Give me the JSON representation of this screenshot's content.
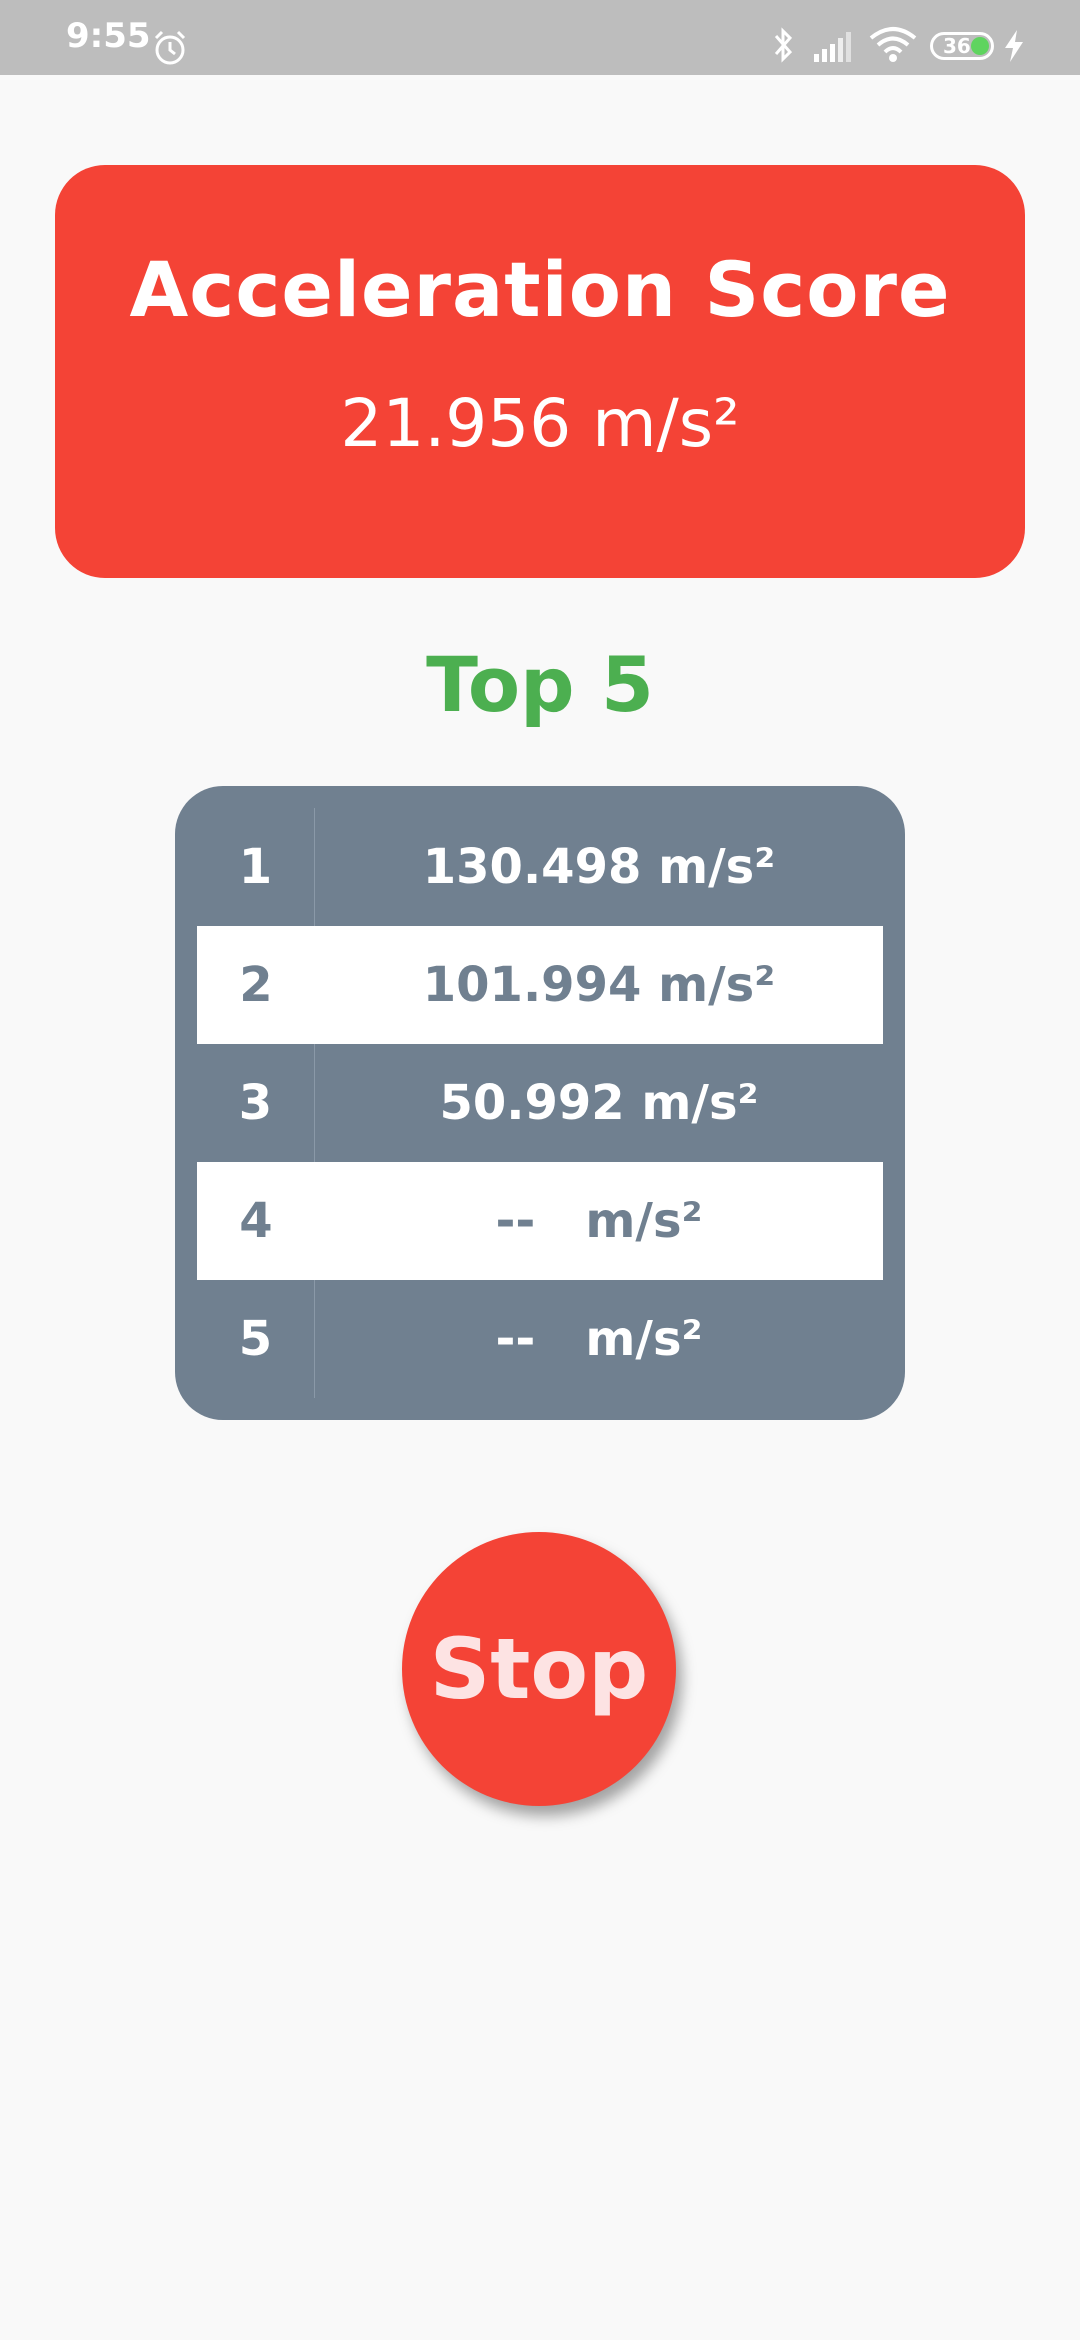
{
  "status_bar": {
    "time": "9:55",
    "battery_level": "36",
    "icons": [
      "alarm-icon",
      "bluetooth-icon",
      "signal-icon",
      "wifi-icon",
      "battery-icon",
      "charging-bolt-icon"
    ]
  },
  "score_card": {
    "title": "Acceleration Score",
    "value": "21.956 m/s²",
    "color": "#f44336"
  },
  "top5": {
    "title": "Top 5",
    "color": "#4caf50",
    "rows": [
      {
        "rank": "1",
        "value": "130.498 m/s²"
      },
      {
        "rank": "2",
        "value": "101.994 m/s²"
      },
      {
        "rank": "3",
        "value": "50.992 m/s²"
      },
      {
        "rank": "4",
        "value": "--   m/s²"
      },
      {
        "rank": "5",
        "value": "--   m/s²"
      }
    ]
  },
  "stop_button": {
    "label": "Stop"
  }
}
